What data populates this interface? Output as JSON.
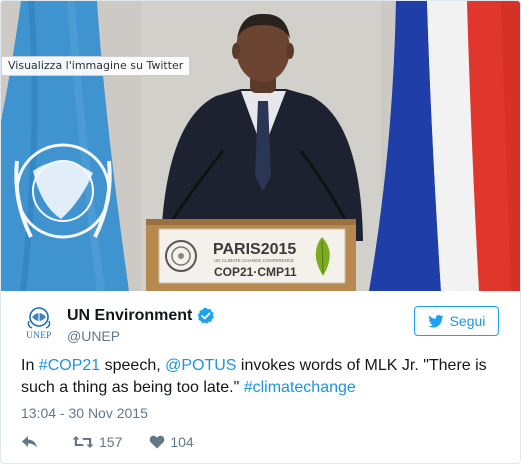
{
  "photo": {
    "view_on_twitter_label": "Visualizza l'immagine su Twitter",
    "podium": {
      "event_title": "PARIS2015",
      "event_subtitle": "UN CLIMATE CHANGE CONFERENCE",
      "event_code": "COP21·CMP11"
    },
    "colors": {
      "un_flag": "#3f93cf",
      "french_blue": "#1f3ea8",
      "french_red": "#e0362c"
    }
  },
  "tweet": {
    "author_name": "UN Environment",
    "handle": "@UNEP",
    "avatar_text": "UNEP",
    "follow_label": "Segui",
    "text_parts": {
      "p1": "In ",
      "hashtag_cop21": "#COP21",
      "p2": " speech, ",
      "mention_potus": "@POTUS",
      "p3": " invokes words of MLK Jr. \"There is such a thing as being too late.\" ",
      "hashtag_climate": "#climatechange"
    },
    "timestamp": "13:04 - 30 Nov 2015",
    "retweet_count": "157",
    "like_count": "104",
    "icons": [
      "reply-icon",
      "retweet-icon",
      "heart-icon",
      "verified-icon",
      "twitter-bird-icon"
    ],
    "colors": {
      "link": "#1b95e0",
      "muted": "#657786",
      "verified": "#1da1f2"
    }
  }
}
